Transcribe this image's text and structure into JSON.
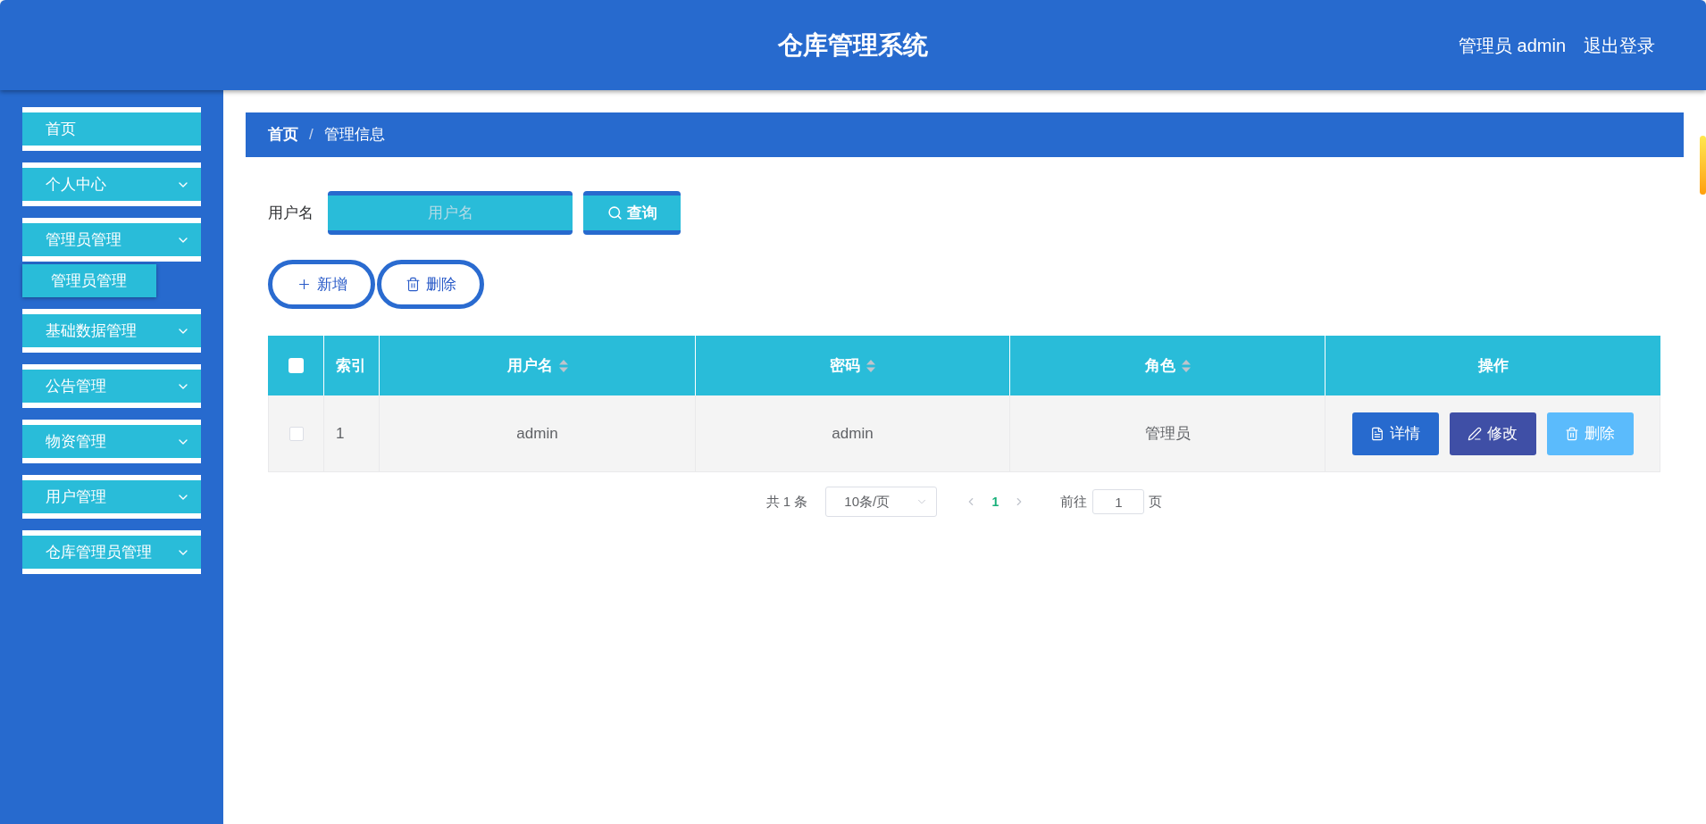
{
  "header": {
    "title": "仓库管理系统",
    "user": "管理员 admin",
    "logout": "退出登录"
  },
  "sidebar": {
    "items": [
      {
        "kind": "link",
        "label": "首页"
      },
      {
        "kind": "submenu",
        "label": "个人中心"
      },
      {
        "kind": "submenu",
        "label": "管理员管理",
        "children": [
          {
            "label": "管理员管理"
          }
        ]
      },
      {
        "kind": "submenu",
        "label": "基础数据管理"
      },
      {
        "kind": "submenu",
        "label": "公告管理"
      },
      {
        "kind": "submenu",
        "label": "物资管理"
      },
      {
        "kind": "submenu",
        "label": "用户管理"
      },
      {
        "kind": "submenu",
        "label": "仓库管理员管理"
      }
    ]
  },
  "breadcrumb": {
    "separator": "/",
    "items": [
      {
        "label": "首页",
        "current": false
      },
      {
        "label": "管理信息",
        "current": true
      }
    ]
  },
  "search": {
    "label": "用户名",
    "placeholder": "用户名",
    "button": "查询"
  },
  "toolbar": [
    {
      "kind": "add",
      "label": "新增"
    },
    {
      "kind": "delete",
      "label": "删除"
    }
  ],
  "table": {
    "select_all": {
      "checked": false
    },
    "columns": [
      {
        "kind": "index",
        "label": "索引",
        "sortable": false
      },
      {
        "kind": "data",
        "label": "用户名",
        "sortable": true
      },
      {
        "kind": "data",
        "label": "密码",
        "sortable": true
      },
      {
        "kind": "data",
        "label": "角色",
        "sortable": true
      },
      {
        "kind": "actions",
        "label": "操作",
        "sortable": false
      }
    ],
    "rows": [
      {
        "selected": false,
        "cells": [
          "1",
          "admin",
          "admin",
          "管理员"
        ],
        "actions": [
          {
            "kind": "detail",
            "label": "详情"
          },
          {
            "kind": "edit",
            "label": "修改"
          },
          {
            "kind": "delete",
            "label": "删除"
          }
        ]
      }
    ]
  },
  "pagination": {
    "total": "共 1 条",
    "page_size": "10条/页",
    "prev_disabled": true,
    "pages": [
      {
        "label": "1",
        "selected": true
      }
    ],
    "next_disabled": true,
    "goto_label": "前往",
    "goto_value": "1",
    "goto_suffix": "页"
  }
}
